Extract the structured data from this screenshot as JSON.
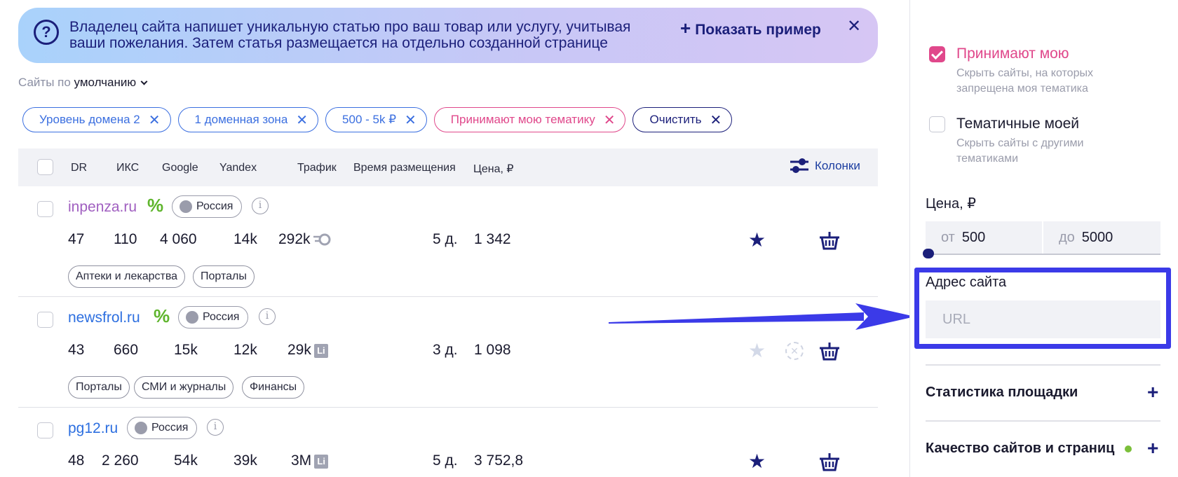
{
  "banner": {
    "text": "Владелец сайта напишет уникальную статью про ваш товар или услугу, учитывая ваши пожелания. Затем статья размещается на отдельно созданной странице",
    "show_example": "Показать пример",
    "close": "✕"
  },
  "sort": {
    "prefix": "Сайты по",
    "value": "умолчанию"
  },
  "chips": [
    {
      "label": "Уровень домена 2"
    },
    {
      "label": "1 доменная зона"
    },
    {
      "label": "500 - 5k ₽"
    },
    {
      "label": "Принимают мою тематику"
    },
    {
      "label": "Очистить"
    }
  ],
  "table": {
    "headers": [
      "DR",
      "ИКС",
      "Google",
      "Yandex",
      "Трафик",
      "Время размещения",
      "Цена, ₽"
    ],
    "columns_btn": "Колонки",
    "rows": [
      {
        "domain": "inpenza.ru",
        "country": "Россия",
        "dr": "47",
        "iks": "110",
        "google": "4 060",
        "yandex": "14k",
        "traffic": "292k",
        "time": "5 д.",
        "price": "1 342",
        "tags": [
          "Аптеки и лекарства",
          "Порталы"
        ]
      },
      {
        "domain": "newsfrol.ru",
        "country": "Россия",
        "dr": "43",
        "iks": "660",
        "google": "15k",
        "yandex": "12k",
        "traffic": "29k",
        "time": "3 д.",
        "price": "1 098",
        "tags": [
          "Порталы",
          "СМИ и журналы",
          "Финансы"
        ]
      },
      {
        "domain": "pg12.ru",
        "country": "Россия",
        "dr": "48",
        "iks": "2 260",
        "google": "54k",
        "yandex": "39k",
        "traffic": "3M",
        "time": "5 д.",
        "price": "3 752,8",
        "tags": []
      }
    ]
  },
  "sidebar": {
    "accept_theme": {
      "title": "Принимают мою",
      "sub": "Скрыть сайты, на которых запрещена моя тематика"
    },
    "thematic": {
      "title": "Тематичные моей",
      "sub": "Скрыть сайты с другими тематиками"
    },
    "price": {
      "label": "Цена, ₽",
      "from_prefix": "от",
      "from": "500",
      "to_prefix": "до",
      "to": "5000"
    },
    "address": {
      "label": "Адрес сайта",
      "placeholder": "URL"
    },
    "stats": "Статистика площадки",
    "quality": "Качество сайтов и страниц"
  },
  "colors": {
    "accent": "#1b1f7a",
    "link": "#2d6fe0",
    "pink": "#e0488b",
    "highlight": "#3b3ae8"
  }
}
